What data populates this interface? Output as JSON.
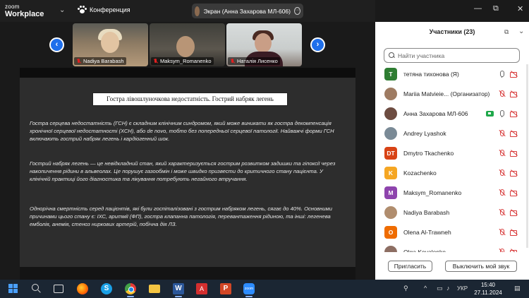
{
  "app": {
    "logo_line1": "zoom",
    "logo_line2": "Workplace",
    "menu_chevron": "⌄",
    "conference_label": "Конференция",
    "share_label": "Экран (Анна Захарова МЛ-606)",
    "share_menu": "···"
  },
  "window": {
    "minimize": "—",
    "maximize": "⧉",
    "close": "✕"
  },
  "videos": {
    "prev": "‹",
    "next": "›",
    "tiles": [
      {
        "name": "Nadiya Barabash"
      },
      {
        "name": "Maksym_Romanenko"
      },
      {
        "name": "Наталія Лисенко"
      }
    ]
  },
  "slide": {
    "title": "Гостра лівошлуночкова недостатність. Гострий набряк легень",
    "p1": "Гостра серцева недостатність (ГСН) є складним клінічним синдромом, який може виникати як гостра декомпенсація хронічної серцевої недостатності (ХСН), або de novo, тобто без попередньої серцевої патології. Найважчі форми ГСН включають гострий набряк легень і кардіогенний шок.",
    "p2": "Гострий набряк легень — це невідкладний стан, який характеризується гострим розвитком задишки та гіпоксії через накопичення рідини в альвеолах. Це порушує газообмін і може швидко призвести до критичного стану пацієнта. У клінічній практиці його діагностика та лікування потребують негайного втручання.",
    "p3": "Однорічна смертність серед пацієнтів, які були госпіталізовані з гострим набряком легень, сягає до 40%. Основними причинами цього стану є: ІХС, аритмії (ФП), гостра клапанна патологія, перевантаження рідиною, та інші: легенева емболія, анемія, стеноз ниркових артерій, побічна дія ЛЗ."
  },
  "participants": {
    "title": "Участники (23)",
    "popout": "⧉",
    "close": "⌄",
    "search_placeholder": "Найти участника",
    "list": [
      {
        "name": "тетяна тихонова (Я)",
        "initial": "T",
        "color": "#2e7d32",
        "mic": "on",
        "cam": "off"
      },
      {
        "name": "Mariia Matvieie... (Организатор)",
        "initial": "",
        "color": "#9e7b62",
        "mic": "off",
        "cam": "off"
      },
      {
        "name": "Анна Захарова МЛ-606",
        "initial": "",
        "color": "#6d4c41",
        "mic": "on",
        "cam": "off",
        "sharing": true
      },
      {
        "name": "Andrey Lyashok",
        "initial": "",
        "color": "#7a8a96",
        "mic": "off",
        "cam": "off"
      },
      {
        "name": "Dmytro Tkachenko",
        "initial": "DT",
        "color": "#d84315",
        "mic": "off",
        "cam": "off"
      },
      {
        "name": "Kozachenko",
        "initial": "K",
        "color": "#f5a623",
        "mic": "off",
        "cam": "off"
      },
      {
        "name": "Maksym_Romanenko",
        "initial": "M",
        "color": "#8e44ad",
        "mic": "off",
        "cam": "off"
      },
      {
        "name": "Nadiya Barabash",
        "initial": "",
        "color": "#b08d6e",
        "mic": "off",
        "cam": "off"
      },
      {
        "name": "Olena Al-Trawneh",
        "initial": "O",
        "color": "#ef6c00",
        "mic": "off",
        "cam": "off"
      },
      {
        "name": "Olga Kovalenko",
        "initial": "",
        "color": "#8d6e63",
        "mic": "off",
        "cam": "off"
      }
    ],
    "invite_label": "Пригласить",
    "mute_label": "Выключить мой звук"
  },
  "taskbar": {
    "skype": "S",
    "word": "W",
    "pdf": "A",
    "ppt": "P",
    "zoom": "zoom",
    "lang": "УКР",
    "time": "15:40",
    "date": "27.11.2024",
    "tray_up": "^",
    "tray_people": "⚲",
    "tray_net": "▭",
    "tray_vol": "♪",
    "tray_bell": "▤"
  }
}
